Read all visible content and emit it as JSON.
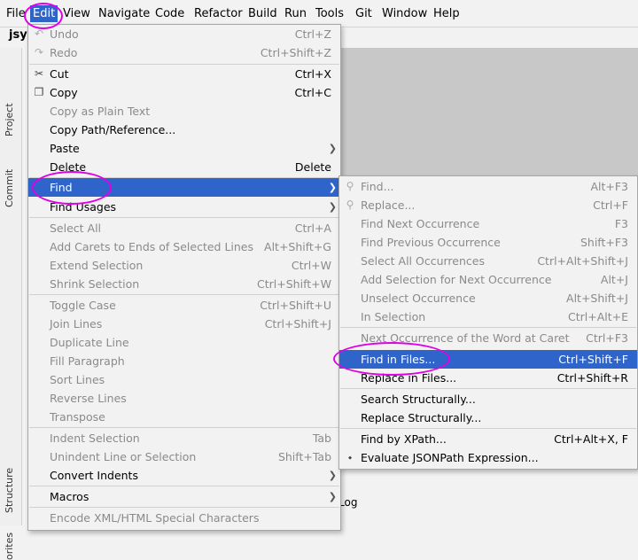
{
  "menubar": {
    "items": [
      "File",
      "Edit",
      "View",
      "Navigate",
      "Code",
      "Refactor",
      "Build",
      "Run",
      "Tools",
      "Git",
      "Window",
      "Help"
    ]
  },
  "background": {
    "project_name": "jsy",
    "side_tabs": [
      "Project",
      "Commit",
      "Structure",
      "orites"
    ],
    "bottom_text": "Log"
  },
  "edit_menu": {
    "items": [
      {
        "label": "Undo",
        "shortcut": "Ctrl+Z",
        "icon": "undo-icon"
      },
      {
        "label": "Redo",
        "shortcut": "Ctrl+Shift+Z",
        "icon": "redo-icon"
      },
      {
        "label": "Cut",
        "shortcut": "Ctrl+X",
        "icon": "scissors-icon"
      },
      {
        "label": "Copy",
        "shortcut": "Ctrl+C",
        "icon": "copy-icon"
      },
      {
        "label": "Copy as Plain Text",
        "shortcut": ""
      },
      {
        "label": "Copy Path/Reference...",
        "shortcut": ""
      },
      {
        "label": "Paste",
        "shortcut": ""
      },
      {
        "label": "Delete",
        "shortcut": "Delete"
      },
      {
        "label": "Find",
        "shortcut": ""
      },
      {
        "label": "Find Usages",
        "shortcut": ""
      },
      {
        "label": "Select All",
        "shortcut": "Ctrl+A"
      },
      {
        "label": "Add Carets to Ends of Selected Lines",
        "shortcut": "Alt+Shift+G"
      },
      {
        "label": "Extend Selection",
        "shortcut": "Ctrl+W"
      },
      {
        "label": "Shrink Selection",
        "shortcut": "Ctrl+Shift+W"
      },
      {
        "label": "Toggle Case",
        "shortcut": "Ctrl+Shift+U"
      },
      {
        "label": "Join Lines",
        "shortcut": "Ctrl+Shift+J"
      },
      {
        "label": "Duplicate Line",
        "shortcut": ""
      },
      {
        "label": "Fill Paragraph",
        "shortcut": ""
      },
      {
        "label": "Sort Lines",
        "shortcut": ""
      },
      {
        "label": "Reverse Lines",
        "shortcut": ""
      },
      {
        "label": "Transpose",
        "shortcut": ""
      },
      {
        "label": "Indent Selection",
        "shortcut": "Tab"
      },
      {
        "label": "Unindent Line or Selection",
        "shortcut": "Shift+Tab"
      },
      {
        "label": "Convert Indents",
        "shortcut": ""
      },
      {
        "label": "Macros",
        "shortcut": ""
      },
      {
        "label": "Encode XML/HTML Special Characters",
        "shortcut": ""
      }
    ]
  },
  "find_menu": {
    "items": [
      {
        "label": "Find...",
        "shortcut": "Alt+F3",
        "icon": "search-icon"
      },
      {
        "label": "Replace...",
        "shortcut": "Ctrl+F",
        "icon": "replace-icon"
      },
      {
        "label": "Find Next Occurrence",
        "shortcut": "F3"
      },
      {
        "label": "Find Previous Occurrence",
        "shortcut": "Shift+F3"
      },
      {
        "label": "Select All Occurrences",
        "shortcut": "Ctrl+Alt+Shift+J"
      },
      {
        "label": "Add Selection for Next Occurrence",
        "shortcut": "Alt+J"
      },
      {
        "label": "Unselect Occurrence",
        "shortcut": "Alt+Shift+J"
      },
      {
        "label": "In Selection",
        "shortcut": "Ctrl+Alt+E"
      },
      {
        "label": "Next Occurrence of the Word at Caret",
        "shortcut": "Ctrl+F3"
      },
      {
        "label": "Find in Files...",
        "shortcut": "Ctrl+Shift+F"
      },
      {
        "label": "Replace in Files...",
        "shortcut": "Ctrl+Shift+R"
      },
      {
        "label": "Search Structurally...",
        "shortcut": ""
      },
      {
        "label": "Replace Structurally...",
        "shortcut": ""
      },
      {
        "label": "Find by XPath...",
        "shortcut": "Ctrl+Alt+X, F"
      },
      {
        "label": "Evaluate JSONPath Expression...",
        "shortcut": "",
        "icon": "jsonpath-icon"
      }
    ]
  },
  "colors": {
    "selection": "#2f65ca",
    "highlight_ring": "#e000e8",
    "disabled_text": "#8a8a8a"
  }
}
